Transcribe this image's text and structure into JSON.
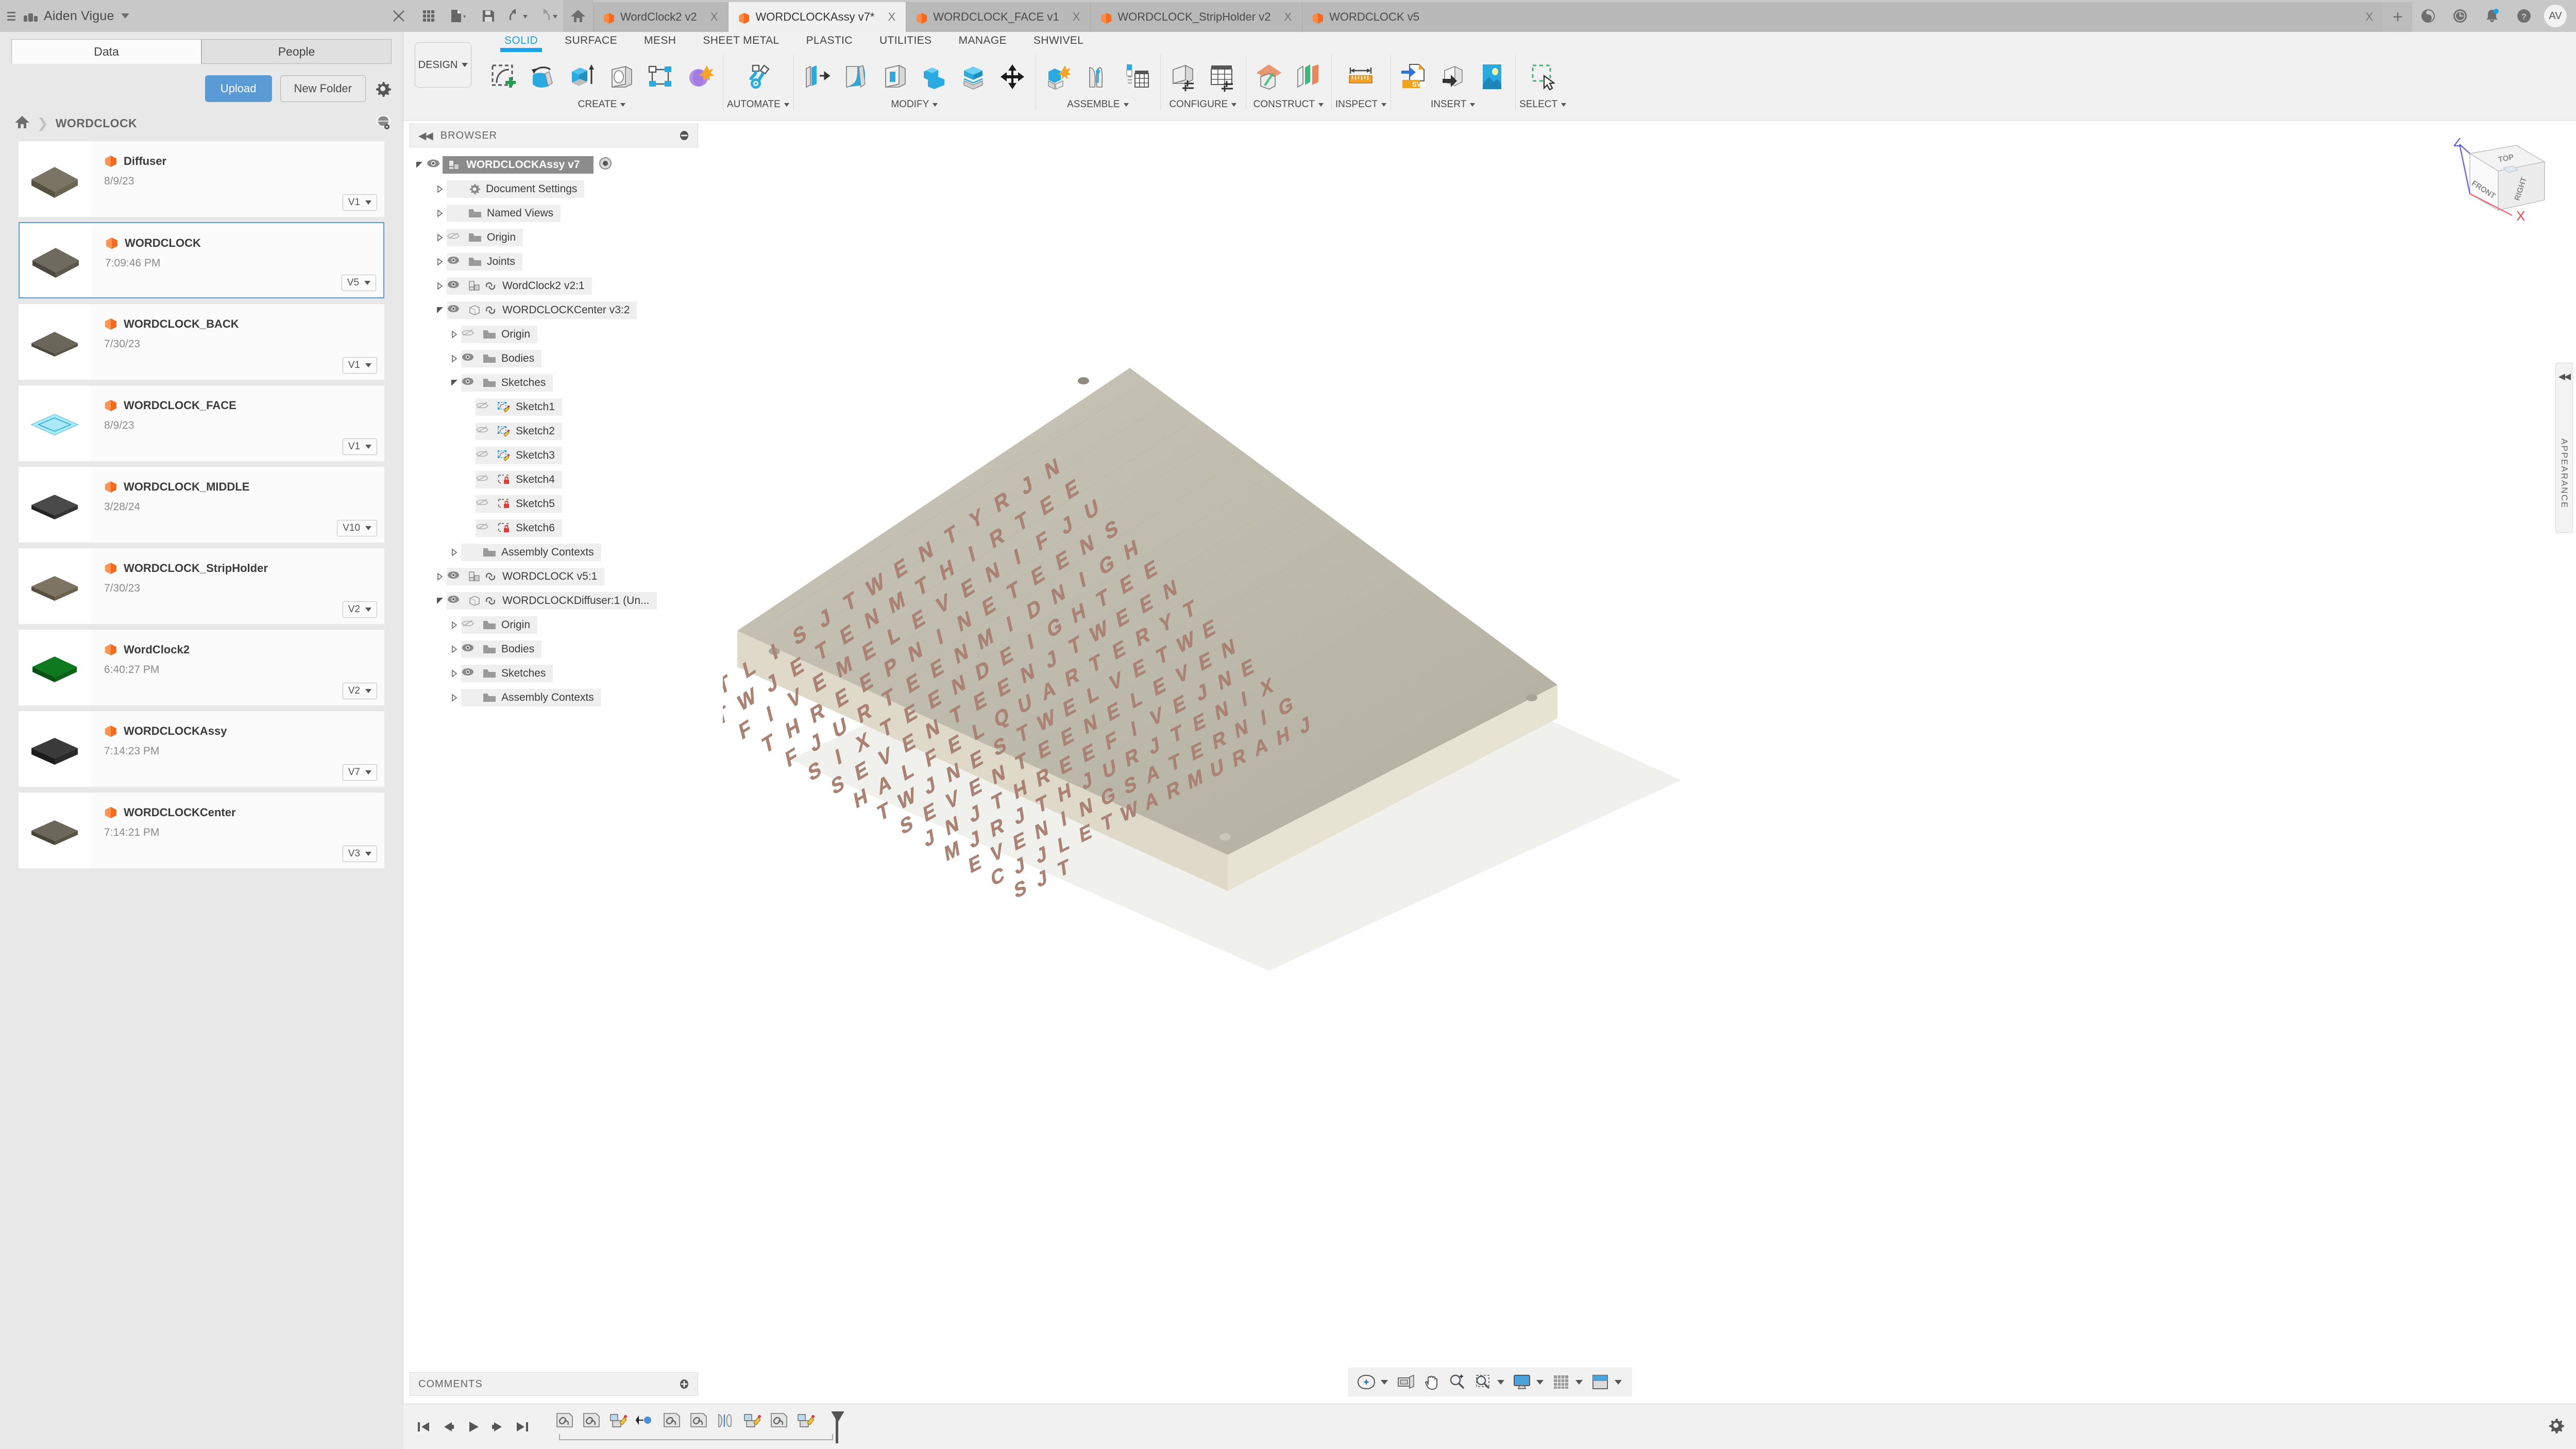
{
  "titlebar": {
    "account_name": "Aiden Vigue",
    "quick_icons": [
      "close-icon",
      "grid-icon",
      "new-file-icon",
      "save-icon",
      "undo-icon",
      "redo-icon",
      "home-icon"
    ],
    "right_icons": [
      "job-status-icon",
      "recent-icon",
      "notifications-icon",
      "help-icon"
    ],
    "avatar_initials": "AV",
    "new_tab_label": "+",
    "close_glyph": "X",
    "doc_tabs": [
      {
        "label": "WordClock2 v2",
        "active": false
      },
      {
        "label": "WORDCLOCKAssy v7*",
        "active": true
      },
      {
        "label": "WORDCLOCK_FACE v1",
        "active": false
      },
      {
        "label": "WORDCLOCK_StripHolder v2",
        "active": false
      },
      {
        "label": "WORDCLOCK v5",
        "active": false
      }
    ]
  },
  "ribbon": {
    "workspace": "DESIGN",
    "tabs": [
      {
        "label": "SOLID",
        "active": true
      },
      {
        "label": "SURFACE",
        "active": false
      },
      {
        "label": "MESH",
        "active": false
      },
      {
        "label": "SHEET METAL",
        "active": false
      },
      {
        "label": "PLASTIC",
        "active": false
      },
      {
        "label": "UTILITIES",
        "active": false
      },
      {
        "label": "MANAGE",
        "active": false
      },
      {
        "label": "SHWIVEL",
        "active": false
      }
    ],
    "panels": [
      {
        "label": "CREATE",
        "tools": [
          "new-sketch-icon",
          "revolve-icon",
          "extrude-icon",
          "hole-icon",
          "pattern-icon",
          "form-icon"
        ]
      },
      {
        "label": "AUTOMATE",
        "tools": [
          "automate-icon"
        ]
      },
      {
        "label": "MODIFY",
        "tools": [
          "press-pull-icon",
          "fillet-icon",
          "shell-icon",
          "combine-icon",
          "split-body-icon",
          "move-copy-icon"
        ]
      },
      {
        "label": "ASSEMBLE",
        "tools": [
          "new-component-icon",
          "joint-icon",
          "bom-icon"
        ]
      },
      {
        "label": "CONFIGURE",
        "tools": [
          "configure-body-icon",
          "configure-table-icon"
        ]
      },
      {
        "label": "CONSTRUCT",
        "tools": [
          "offset-plane-icon",
          "midplane-icon"
        ]
      },
      {
        "label": "INSPECT",
        "tools": [
          "measure-icon"
        ]
      },
      {
        "label": "INSERT",
        "tools": [
          "insert-svg-icon",
          "insert-derive-icon",
          "insert-canvas-icon"
        ]
      },
      {
        "label": "SELECT",
        "tools": [
          "window-select-icon"
        ]
      }
    ]
  },
  "data_panel": {
    "tabs": [
      {
        "label": "Data",
        "active": true
      },
      {
        "label": "People",
        "active": false
      }
    ],
    "upload_label": "Upload",
    "new_folder_label": "New Folder",
    "settings_icon": "gear-icon",
    "breadcrumb_home_icon": "home-icon",
    "breadcrumb_folder": "WORDCLOCK",
    "globe_icon": "globe-view-icon",
    "files": [
      {
        "name": "Diffuser",
        "date": "8/9/23",
        "version": "V1",
        "selected": false,
        "thumb": "#6a6455"
      },
      {
        "name": "WORDCLOCK",
        "date": "7:09:46 PM",
        "version": "V5",
        "selected": true,
        "thumb": "#5f5f5a"
      },
      {
        "name": "WORDCLOCK_BACK",
        "date": "7/30/23",
        "version": "V1",
        "selected": false,
        "thumb": "#5d5d55"
      },
      {
        "name": "WORDCLOCK_FACE",
        "date": "8/9/23",
        "version": "V1",
        "selected": false,
        "thumb": "#7fd8f2"
      },
      {
        "name": "WORDCLOCK_MIDDLE",
        "date": "3/28/24",
        "version": "V10",
        "selected": false,
        "thumb": "#3b3b3b"
      },
      {
        "name": "WORDCLOCK_StripHolder",
        "date": "7/30/23",
        "version": "V2",
        "selected": false,
        "thumb": "#6d6352"
      },
      {
        "name": "WordClock2",
        "date": "6:40:27 PM",
        "version": "V2",
        "selected": false,
        "thumb": "#0f6b1e"
      },
      {
        "name": "WORDCLOCKAssy",
        "date": "7:14:23 PM",
        "version": "V7",
        "selected": false,
        "thumb": "#2e2e2e"
      },
      {
        "name": "WORDCLOCKCenter",
        "date": "7:14:21 PM",
        "version": "V3",
        "selected": false,
        "thumb": "#5b5b52"
      }
    ]
  },
  "browser": {
    "title": "BROWSER",
    "collapse_icon": "collapse-left-icon",
    "options_icon": "panel-options-icon",
    "root": {
      "label": "WORDCLOCKAssy v7",
      "icon": "assembly-icon",
      "visible": true,
      "expanded": true
    },
    "nodes": [
      {
        "label": "Document Settings",
        "indent": 1,
        "twisty": "closed",
        "eye": "none",
        "icon": "gear-icon"
      },
      {
        "label": "Named Views",
        "indent": 1,
        "twisty": "closed",
        "eye": "none",
        "icon": "folder-icon"
      },
      {
        "label": "Origin",
        "indent": 1,
        "twisty": "closed",
        "eye": "hidden",
        "icon": "folder-icon"
      },
      {
        "label": "Joints",
        "indent": 1,
        "twisty": "closed",
        "eye": "shown",
        "icon": "folder-icon"
      },
      {
        "label": "WordClock2 v2:1",
        "indent": 1,
        "twisty": "closed",
        "eye": "shown",
        "icon": "assembly-link-icon"
      },
      {
        "label": "WORDCLOCKCenter v3:2",
        "indent": 1,
        "twisty": "open",
        "eye": "shown",
        "icon": "component-link-icon"
      },
      {
        "label": "Origin",
        "indent": 2,
        "twisty": "closed",
        "eye": "hidden",
        "icon": "folder-icon"
      },
      {
        "label": "Bodies",
        "indent": 2,
        "twisty": "closed",
        "eye": "shown",
        "icon": "folder-icon"
      },
      {
        "label": "Sketches",
        "indent": 2,
        "twisty": "open",
        "eye": "shown",
        "icon": "folder-icon"
      },
      {
        "label": "Sketch1",
        "indent": 3,
        "twisty": "none",
        "eye": "hidden",
        "icon": "sketch-edit-icon"
      },
      {
        "label": "Sketch2",
        "indent": 3,
        "twisty": "none",
        "eye": "hidden",
        "icon": "sketch-edit-icon"
      },
      {
        "label": "Sketch3",
        "indent": 3,
        "twisty": "none",
        "eye": "hidden",
        "icon": "sketch-edit-icon"
      },
      {
        "label": "Sketch4",
        "indent": 3,
        "twisty": "none",
        "eye": "hidden",
        "icon": "sketch-locked-icon"
      },
      {
        "label": "Sketch5",
        "indent": 3,
        "twisty": "none",
        "eye": "hidden",
        "icon": "sketch-locked-icon"
      },
      {
        "label": "Sketch6",
        "indent": 3,
        "twisty": "none",
        "eye": "hidden",
        "icon": "sketch-locked-icon"
      },
      {
        "label": "Assembly Contexts",
        "indent": 2,
        "twisty": "closed",
        "eye": "none",
        "icon": "folder-icon"
      },
      {
        "label": "WORDCLOCK v5:1",
        "indent": 1,
        "twisty": "closed",
        "eye": "shown",
        "icon": "assembly-link-icon"
      },
      {
        "label": "WORDCLOCKDiffuser:1 (Un...",
        "indent": 1,
        "twisty": "open",
        "eye": "shown",
        "icon": "component-link-icon"
      },
      {
        "label": "Origin",
        "indent": 2,
        "twisty": "closed",
        "eye": "hidden",
        "icon": "folder-icon"
      },
      {
        "label": "Bodies",
        "indent": 2,
        "twisty": "closed",
        "eye": "shown",
        "icon": "folder-icon"
      },
      {
        "label": "Sketches",
        "indent": 2,
        "twisty": "closed",
        "eye": "shown",
        "icon": "folder-icon"
      },
      {
        "label": "Assembly Contexts",
        "indent": 2,
        "twisty": "closed",
        "eye": "none",
        "icon": "folder-icon"
      }
    ]
  },
  "canvas": {
    "viewcube": {
      "top": "TOP",
      "front": "FRONT",
      "right": "RIGHT",
      "axis_z": "Z",
      "axis_x": "X"
    },
    "appearance_rail": {
      "label": "APPEARANCE",
      "collapse_icon": "collapse-right-icon"
    },
    "model": {
      "name": "word-clock-face",
      "plate_color": "#bfbbae",
      "letter_color": "#b08070",
      "rows": [
        "ITLISJTWENTYRJN",
        "TWJETENMTHIRTEE",
        "FIVEMELEVENIFJU",
        "THREEPNINETEENS",
        "FJURTEENMIDNIGH",
        "SIXTEENDEIGHTEE",
        "SEVENTEENJTWEEN",
        "HALFELQUARTERYT",
        "TWJNESTWELVETWE",
        "SEVENTEENELEVEN",
        "JNJTHREEFIVEJNE",
        "MJRJTHJURJTENIX",
        "EVENINGSATERNIG",
        "CJJLETWARMURAHJ",
        "SJT"
      ]
    },
    "navbar_icons": [
      "orbit-icon",
      "look-at-icon",
      "pan-icon",
      "zoom-icon",
      "zoom-window-icon",
      "display-settings-icon",
      "grid-snap-icon",
      "viewports-icon"
    ]
  },
  "comments": {
    "title": "COMMENTS",
    "options_icon": "panel-options-icon"
  },
  "timeline": {
    "nav_icons": [
      "jump-start-icon",
      "step-back-icon",
      "play-icon",
      "step-forward-icon",
      "jump-end-icon"
    ],
    "features": [
      "link-feature-icon",
      "link-feature-icon",
      "sketch-feature-icon",
      "joint-feature-icon",
      "link-feature-icon",
      "link-feature-icon",
      "mirror-feature-icon",
      "sketch-feature-icon",
      "link-feature-icon",
      "sketch-feature-icon"
    ],
    "marker_icon": "timeline-marker-icon",
    "settings_icon": "settings-icon"
  },
  "colors": {
    "accent_blue": "#1aa3e8",
    "upload_blue": "#5b9bd5",
    "fusion_orange": "#f26b21",
    "panel_bg": "#f1f1f1",
    "titlebar_bg": "#c8c8c8",
    "selection_grey": "#8c8c8c"
  }
}
